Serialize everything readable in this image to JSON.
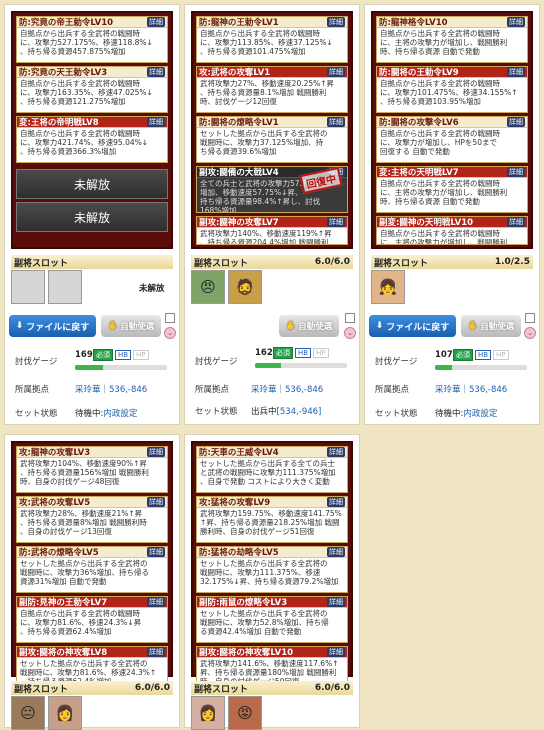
{
  "cards": [
    {
      "skills": [
        {
          "name": "防:究竟の帝王勅令LV10",
          "style": "",
          "desc": "自拠点から出兵する全武将の戦闘時\nに、攻撃力527.175%、移速118.8%↓\n、持ち帰る資源457.875%増加"
        },
        {
          "name": "防:究竟の天王勅令LV3",
          "style": "",
          "desc": "自拠点から出兵する全武将の戦闘時\nに、攻撃力163.35%、移速47.025%↓\n、持ち帰る資源121.275%増加"
        },
        {
          "name": "変:王将の帝明戦LV8",
          "style": "red",
          "desc": "自拠点から出兵する全武将の戦闘時\nに、攻撃力421.74%、移速95.04%↓\n、持ち帰る資源366.3%増加"
        }
      ],
      "locked": [
        "未解放",
        "未解放"
      ],
      "sub_title": "副将スロット",
      "sub_count": "",
      "avatars": [
        "",
        ""
      ],
      "unlock": "未解放",
      "gauge": "169",
      "rank": "",
      "base": "采玲華｜536,-846",
      "status_text": "待機中:",
      "status_link": "内政設定"
    },
    {
      "skills": [
        {
          "name": "防:龍神の王勅令LV1",
          "style": "",
          "desc": "自拠点から出兵する全武将の戦闘時\nに、攻撃力113.85%、移速37.125%↓\n、持ち帰る資源101.475%増加"
        },
        {
          "name": "攻:武将の攻奪LV1",
          "style": "red",
          "desc": "武将攻撃力27%、移動速度20.25%↑昇\n、持ち帰る資源量8.1%増加 戦闘勝利\n時、討伐ゲージ12回復"
        },
        {
          "name": "防:闘将の燎略令LV1",
          "style": "",
          "desc": "セットした拠点から出兵する全武将の\n戦闘時に、攻撃力37.125%増加、持\nち帰る資源39.6%増加"
        },
        {
          "name": "副攻:闘備の大戟LV4",
          "style": "dark",
          "desc": "全ての兵士と武将の攻撃力57.75%\n増加、移動速度57.75%↓昇、\n持ち帰る資源量98.4%↑昇し、討伐\n168%増加"
        },
        {
          "name": "副攻:闘神の攻奪LV7",
          "style": "red",
          "desc": "武将攻撃力140%、移動速度119%↑昇\n、持ち帰る資源204.4%増加 戦闘勝利\n時、自身の討伐ゲージ30回復"
        }
      ],
      "stamp": "回復中",
      "sub_title": "副将スロット",
      "sub_count": "6.0/6.0",
      "avatars": [
        "😠",
        "🧔"
      ],
      "gauge": "162",
      "rank": "",
      "base": "采玲華｜536,-846",
      "status_text": "出兵中",
      "status_link": "[534,-946]"
    },
    {
      "skills": [
        {
          "name": "防:龍神格令LV10",
          "style": "",
          "desc": "自拠点から出兵する全武将の戦闘時\nに、主将の攻撃力が増加し、戦闘勝利\n時、持ち帰る資源 自動で発動"
        },
        {
          "name": "防:闘将の王勅令LV9",
          "style": "red",
          "desc": "自拠点から出兵する全武将の戦闘時\nに、攻撃力101.475%、移速34.155%↑\n、持ち帰る資源103.95%増加"
        },
        {
          "name": "防:闘将の攻撃令LV6",
          "style": "",
          "desc": "自拠点から出兵する全武将の戦闘時\nに、攻撃力が増加し、HPを50まで\n回復する 自動で発動"
        },
        {
          "name": "変:主将の天明戦LV7",
          "style": "red",
          "desc": "自拠点から出兵する全武将の戦闘時\nに、主将の攻撃力が増加し、戦闘勝利\n時、持ち帰る資源 自動で発動"
        },
        {
          "name": "副変:闘神の天明戦LV10",
          "style": "red",
          "desc": "自拠点から出兵する全武将の戦闘時\nに、主将の攻撃力が増加し、戦闘勝利\n時 自動で発動"
        }
      ],
      "sub_title": "副将スロット",
      "sub_count": "1.0/2.5",
      "avatars": [
        "👧"
      ],
      "gauge": "107",
      "rank": "",
      "base": "采玲華｜536,-846",
      "status_text": "待機中:",
      "status_link": "内政設定"
    },
    {
      "skills": [
        {
          "name": "攻:龍神の攻奪LV3",
          "style": "",
          "desc": "武将攻撃力104%、移動速度90%↑昇\n、持ち帰る資源量156%増加 戦闘勝利\n時、自身の討伐ゲージ48回復"
        },
        {
          "name": "攻:武将の攻奪LV5",
          "style": "",
          "desc": "武将攻撃力28%、移動速度21%↑昇\n、持ち帰る資源量8%増加 戦闘勝利時\n、自身の討伐ゲージ13回復"
        },
        {
          "name": "防:武将の燎略令LV5",
          "style": "",
          "desc": "セットした拠点から出兵する全武将の\n戦闘時に、攻撃力36%増加、持ち帰る\n資源31%増加 自動で発動"
        },
        {
          "name": "副防:見神の王勅令LV7",
          "style": "red",
          "desc": "自拠点から出兵する全武将の戦闘時\nに、攻撃力81.6%、移速24.3%↓昇\n、持ち帰る資源62.4%増加"
        },
        {
          "name": "副攻:闘将の神攻奪LV8",
          "style": "red",
          "desc": "セットした拠点から出兵する全武将の\n戦闘時に、攻撃力81.6%、移速24.3%↑\n、持ち帰る資源62.4%増加"
        }
      ],
      "sub_title": "副将スロット",
      "sub_count": "6.0/6.0",
      "avatars": [
        "😐",
        "👩"
      ],
      "gauge": "",
      "rank": "",
      "base": "",
      "status_text": "",
      "status_link": ""
    },
    {
      "skills": [
        {
          "name": "防:天車の王威令LV4",
          "style": "",
          "desc": "セットした拠点から出兵する全ての兵士\nと武将の戦闘時に攻撃力111.375%増加\n、自身で発動 コストにより大きく変動"
        },
        {
          "name": "攻:猛将の攻奪LV9",
          "style": "",
          "desc": "武将攻撃力159.75%、移動速度141.75%\n↑昇、持ち帰る資源量218.25%増加 戦闘\n勝利時、自身の討伐ゲージ51回復"
        },
        {
          "name": "防:猛将の劫略令LV5",
          "style": "",
          "desc": "セットした拠点から出兵する全武将の\n戦闘時に、攻撃力111.375%、移速\n32.175%↓昇、持ち帰る資源79.2%増加"
        },
        {
          "name": "副防:雨鼠の燎略令LV3",
          "style": "red",
          "desc": "セットした拠点から出兵する全武将の\n戦闘時に、攻撃力52.8%増加、持ち帰\nる資源42.4%増加 自動で発動"
        },
        {
          "name": "副攻:闘将の神攻奪LV10",
          "style": "red",
          "desc": "武将攻撃力141.6%、移動速度117.6%↑\n昇、持ち帰る資源量180%増加 戦闘勝利\n時、自身の討伐ゲージ50回復"
        }
      ],
      "sub_title": "副将スロット",
      "sub_count": "6.0/6.0",
      "avatars": [
        "👩",
        "😡"
      ],
      "gauge": "",
      "rank": "",
      "base": "",
      "status_text": "",
      "status_link": ""
    }
  ],
  "labels": {
    "detail": "詳細",
    "file_btn": "ファイルに戻す",
    "auto_btn": "自動使選",
    "gauge_label": "討伐ゲージ",
    "base_label": "所属拠点",
    "status_label": "セット状態",
    "b1": "必須",
    "b2": "HB",
    "b3": "HP"
  },
  "colors": {
    "accent": "#1a5fae",
    "panel": "#5a0d08",
    "gauge": "#3fb44a"
  }
}
